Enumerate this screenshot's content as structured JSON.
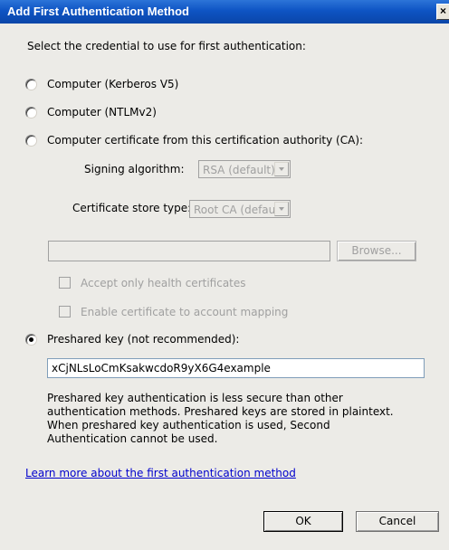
{
  "window": {
    "title": "Add First Authentication Method",
    "close_label": "×"
  },
  "instruction": "Select the credential to use for first authentication:",
  "options": {
    "kerberos": {
      "label": "Computer (Kerberos V5)",
      "selected": false
    },
    "ntlm": {
      "label": "Computer (NTLMv2)",
      "selected": false
    },
    "certificate": {
      "label": "Computer certificate from this certification authority (CA):",
      "selected": false
    },
    "preshared": {
      "label": "Preshared key (not recommended):",
      "selected": true
    }
  },
  "certificate": {
    "signing_algorithm_label": "Signing algorithm:",
    "signing_algorithm_value": "RSA (default)",
    "store_type_label": "Certificate store type:",
    "store_type_value": "Root CA (default)",
    "ca_value": "",
    "browse_label": "Browse...",
    "health_label": "Accept only health certificates",
    "mapping_label": "Enable certificate to account mapping"
  },
  "preshared": {
    "key_value": "xCjNLsLoCmKsakwcdoR9yX6G4example",
    "warning": "Preshared key authentication is less secure than other\nauthentication methods. Preshared keys are stored in plaintext.\nWhen preshared key authentication is used, Second\nAuthentication cannot be used."
  },
  "learn_more_link": "Learn more about the first authentication method",
  "buttons": {
    "ok": "OK",
    "cancel": "Cancel"
  },
  "colors": {
    "titlebar": "#0e54c4",
    "background": "#ecebe7",
    "link": "#0000cc",
    "disabled_text": "#a0a0a0"
  },
  "icons": {
    "close": "close-icon",
    "dropdown": "chevron-down-icon"
  }
}
